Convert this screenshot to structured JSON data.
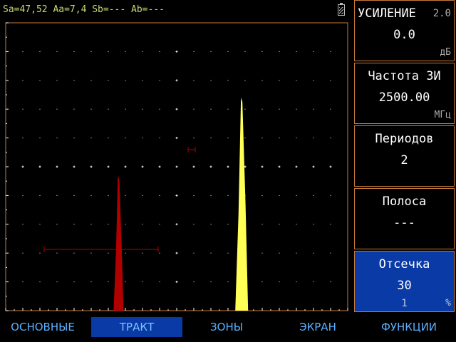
{
  "status": {
    "readout": "Sa=47,52 Aa=7,4 Sb=--- Ab=---"
  },
  "panels": [
    {
      "title": "УСИЛЕНИЕ",
      "extra": "2.0",
      "value": "0.0",
      "unit": "дБ"
    },
    {
      "title": "Частота ЗИ",
      "value": "2500.00",
      "unit": "МГц"
    },
    {
      "title": "Периодов",
      "value": "2"
    },
    {
      "title": "Полоса",
      "value": "---"
    },
    {
      "title": "Отсечка",
      "value": "30",
      "step": "1",
      "unit": "%"
    }
  ],
  "tabs": [
    {
      "label": "ОСНОВНЫЕ"
    },
    {
      "label": "ТРАКТ"
    },
    {
      "label": "ЗОНЫ"
    },
    {
      "label": "ЭКРАН"
    },
    {
      "label": "ФУНКЦИИ"
    }
  ],
  "active_tab": "ТРАКТ",
  "colors": {
    "frame": "#c87a3a",
    "echo_gate_a": "#b00000",
    "echo_gate_b": "#ffff55",
    "accent": "#0a3aa6",
    "status_text": "#c8d870",
    "tab_text": "#5ab0ff"
  },
  "icons": {
    "battery": "battery-icon"
  },
  "signal": {
    "echo_a": {
      "position": 0.33,
      "amplitude": 0.47
    },
    "echo_b": {
      "position": 0.69,
      "amplitude": 0.74
    }
  }
}
